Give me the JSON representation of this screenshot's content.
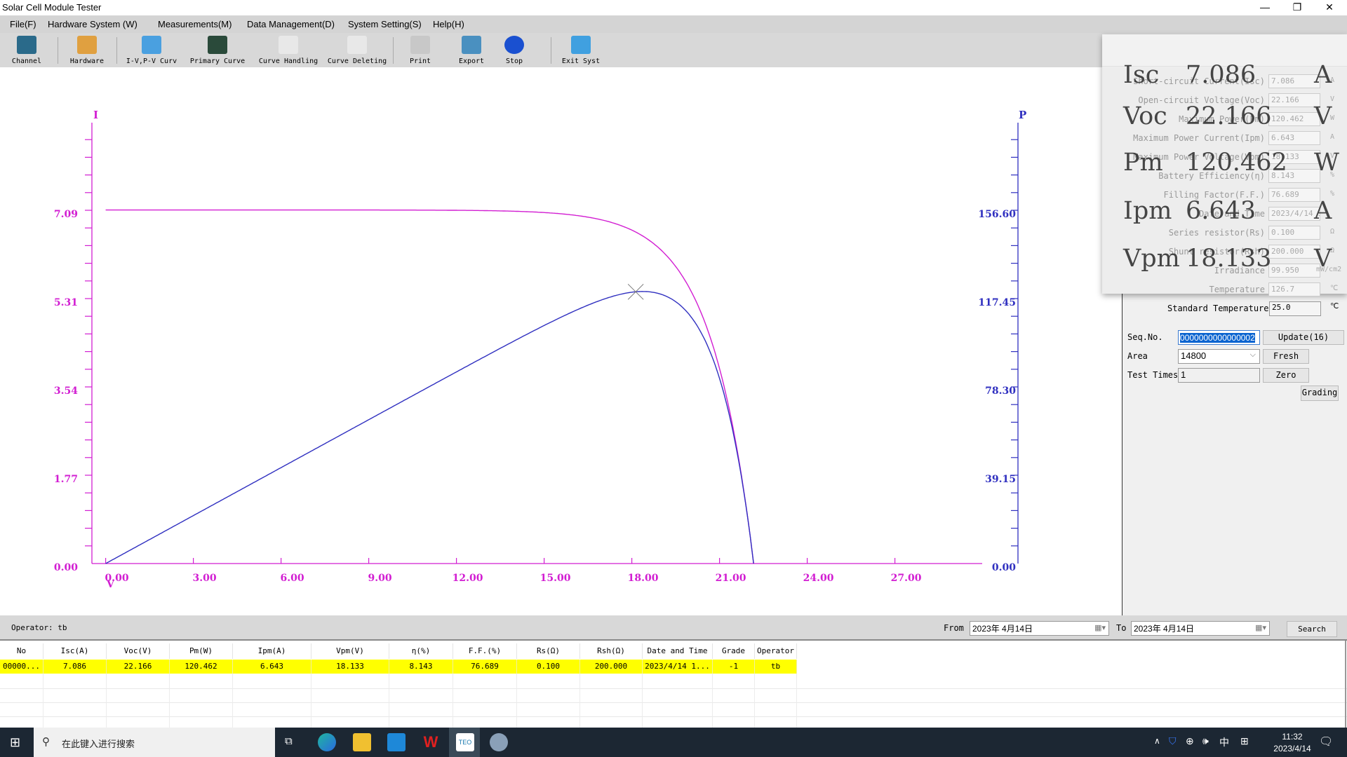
{
  "window": {
    "title": "Solar Cell Module Tester",
    "minimize": "—",
    "restore": "❐",
    "close": "✕"
  },
  "menu": [
    "File(F)",
    "Hardware System  (W)",
    "Measurements(M)",
    "Data Management(D)",
    "System Setting(S)",
    "Help(H)"
  ],
  "toolbar": [
    {
      "label": "Channel",
      "icon": "monitor-icon",
      "color": "#2a6a8a"
    },
    {
      "label": "Hardware",
      "icon": "hardware-card-icon",
      "color": "#e0a040"
    },
    {
      "label": "I-V,P-V Curv",
      "icon": "blueprint-icon",
      "color": "#4aa0e0"
    },
    {
      "label": "Primary Curve",
      "icon": "oscilloscope-icon",
      "color": "#2a4a3a"
    },
    {
      "label": "Curve Handling",
      "icon": "document-arrow-down-icon",
      "color": "#e8e8e8"
    },
    {
      "label": "Curve Deleting",
      "icon": "document-delete-icon",
      "color": "#e8e8e8"
    },
    {
      "label": "Print",
      "icon": "printer-icon",
      "color": "#c8c8c8"
    },
    {
      "label": "Export",
      "icon": "export-folder-icon",
      "color": "#4a90c0"
    },
    {
      "label": "Stop",
      "icon": "stop-icon",
      "color": "#1a50d0"
    },
    {
      "label": "Exit Syst",
      "icon": "exit-icon",
      "color": "#40a0e0"
    }
  ],
  "chart_data": {
    "type": "line",
    "xlabel": "V",
    "ylabel_left": "I",
    "ylabel_right": "P",
    "xlim": [
      0,
      30
    ],
    "ylim_left": [
      0,
      8.85
    ],
    "ylim_right": [
      0,
      195.75
    ],
    "x_ticks": [
      "0.00",
      "3.00",
      "6.00",
      "9.00",
      "12.00",
      "15.00",
      "18.00",
      "21.00",
      "24.00",
      "27.00"
    ],
    "y_left_ticks": [
      "0.00",
      "1.77",
      "3.54",
      "5.31",
      "7.09"
    ],
    "y_right_ticks": [
      "0.00",
      "39.15",
      "78.30",
      "117.45",
      "156.60"
    ],
    "grid": false,
    "colors": {
      "I": "#d21ed2",
      "P": "#3030c0",
      "x_axis": "#d21ed2"
    },
    "series": [
      {
        "axis": "left",
        "x": [
          0,
          3,
          6,
          9,
          12,
          15,
          16,
          17,
          18,
          18.133,
          19,
          20,
          21,
          21.5,
          22,
          22.166
        ],
        "y": [
          7.086,
          7.086,
          7.086,
          7.085,
          7.079,
          7.035,
          6.984,
          6.883,
          6.681,
          6.643,
          6.282,
          5.486,
          3.904,
          2.597,
          0.758,
          0
        ]
      },
      {
        "axis": "right",
        "x": [
          0,
          3,
          6,
          9,
          12,
          15,
          16,
          17,
          18,
          18.133,
          19,
          20,
          21,
          21.5,
          22,
          22.166
        ],
        "y": [
          0,
          21.26,
          42.52,
          63.77,
          84.95,
          105.53,
          111.74,
          117.01,
          120.26,
          120.462,
          119.36,
          109.72,
          81.98,
          55.84,
          16.68,
          0
        ]
      }
    ],
    "max_power_point": {
      "V": 18.133,
      "P": 120.462
    }
  },
  "big_readout": [
    {
      "name": "Isc",
      "value": "7.086",
      "unit": "A"
    },
    {
      "name": "Voc",
      "value": "22.166",
      "unit": "V"
    },
    {
      "name": "Pm",
      "value": "120.462",
      "unit": "W"
    },
    {
      "name": "Ipm",
      "value": "6.643",
      "unit": "A"
    },
    {
      "name": "Vpm",
      "value": "18.133",
      "unit": "V"
    }
  ],
  "params": [
    {
      "label": "Short-circuit Current(Isc)",
      "value": "7.086",
      "unit": "A"
    },
    {
      "label": "Open-circuit Voltage(Voc)",
      "value": "22.166",
      "unit": "V"
    },
    {
      "label": "Maximum Power(Pm)",
      "value": "120.462",
      "unit": "W"
    },
    {
      "label": "Maximum Power Current(Ipm)",
      "value": "6.643",
      "unit": "A"
    },
    {
      "label": "Maximum Power Voltage(Vpm)",
      "value": "18.133",
      "unit": "V"
    },
    {
      "label": "Battery Efficiency(η)",
      "value": "8.143",
      "unit": "%"
    },
    {
      "label": "Filling Factor(F.F.)",
      "value": "76.689",
      "unit": "%"
    },
    {
      "label": "Date and Time",
      "value": "2023/4/14 1",
      "unit": ""
    },
    {
      "label": "Series resistor(Rs)",
      "value": "0.100",
      "unit": "Ω"
    },
    {
      "label": "Shunt resistor(Rsh)",
      "value": "200.000",
      "unit": "Ω"
    },
    {
      "label": "Irradiance",
      "value": "99.950",
      "unit": "mW/cm2"
    },
    {
      "label": "Temperature",
      "value": "126.7",
      "unit": "℃"
    }
  ],
  "settings": {
    "std_temp_label": "Standard Temperature",
    "std_temp_value": "25.0",
    "std_temp_unit": "℃",
    "seq_label": "Seq.No.",
    "seq_value": "0000000000000002",
    "update": "Update(16)",
    "area_label": "Area",
    "area_value": "14800",
    "fresh": "Fresh",
    "times_label": "Test Times",
    "times_value": "1",
    "zero": "Zero",
    "grading": "Grading"
  },
  "filter": {
    "operator": "Operator: tb",
    "from_label": "From",
    "from_value": "2023年 4月14日",
    "to_label": "To",
    "to_value": "2023年 4月14日",
    "search": "Search"
  },
  "table": {
    "columns": [
      "No",
      "Isc(A)",
      "Voc(V)",
      "Pm(W)",
      "Ipm(A)",
      "Vpm(V)",
      "η(%)",
      "F.F.(%)",
      "Rs(Ω)",
      "Rsh(Ω)",
      "Date and Time",
      "Grade",
      "Operator"
    ],
    "rows": [
      [
        "00000...",
        "7.086",
        "22.166",
        "120.462",
        "6.643",
        "18.133",
        "8.143",
        "76.689",
        "0.100",
        "200.000",
        "2023/4/14 1...",
        "-1",
        "tb"
      ]
    ],
    "highlight": "#ffff00"
  },
  "taskbar": {
    "search_placeholder": "在此键入进行搜索",
    "time": "11:32",
    "date": "2023/4/14",
    "ime": "中"
  }
}
